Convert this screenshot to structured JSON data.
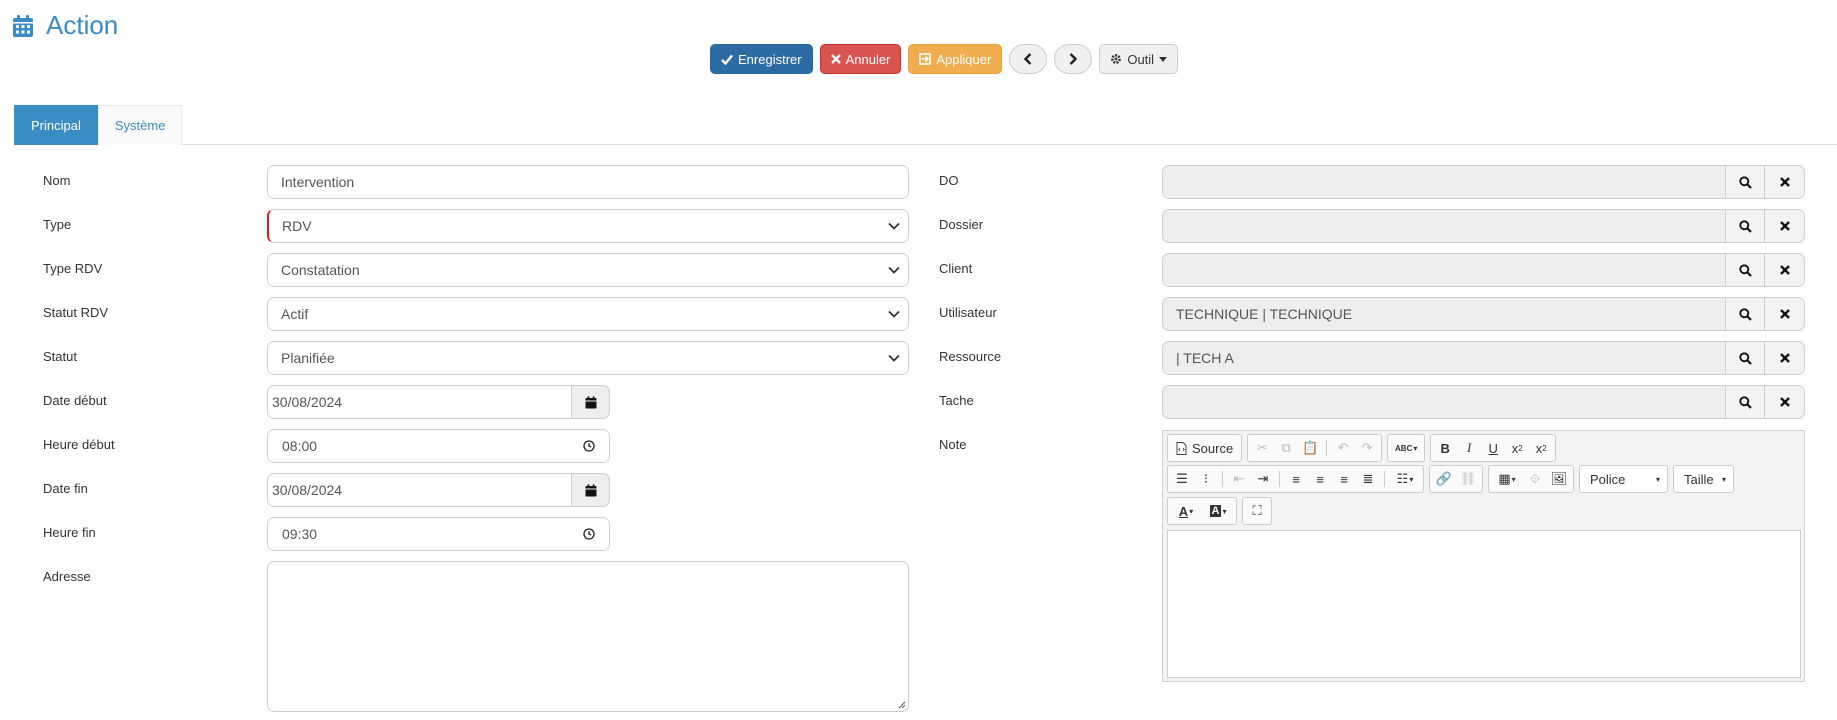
{
  "header": {
    "title": "Action",
    "icon": "calendar-icon"
  },
  "toolbar": {
    "save_label": "Enregistrer",
    "cancel_label": "Annuler",
    "apply_label": "Appliquer",
    "tool_label": "Outil"
  },
  "tabs": [
    {
      "label": "Principal"
    },
    {
      "label": "Système"
    }
  ],
  "left_form": {
    "nom": {
      "label": "Nom",
      "value": "Intervention"
    },
    "type": {
      "label": "Type",
      "value": "RDV"
    },
    "type_rdv": {
      "label": "Type RDV",
      "value": "Constatation"
    },
    "statut_rdv": {
      "label": "Statut RDV",
      "value": "Actif"
    },
    "statut": {
      "label": "Statut",
      "value": "Planifiée"
    },
    "date_debut": {
      "label": "Date début",
      "value": "30/08/2024"
    },
    "heure_debut": {
      "label": "Heure début",
      "value": "08:00"
    },
    "date_fin": {
      "label": "Date fin",
      "value": "30/08/2024"
    },
    "heure_fin": {
      "label": "Heure fin",
      "value": "09:30"
    },
    "adresse": {
      "label": "Adresse",
      "value": ""
    }
  },
  "right_form": {
    "do": {
      "label": "DO",
      "value": ""
    },
    "dossier": {
      "label": "Dossier",
      "value": ""
    },
    "client": {
      "label": "Client",
      "value": ""
    },
    "utilisateur": {
      "label": "Utilisateur",
      "value": "TECHNIQUE | TECHNIQUE"
    },
    "ressource": {
      "label": "Ressource",
      "value": " | TECH A"
    },
    "tache": {
      "label": "Tache",
      "value": ""
    },
    "note": {
      "label": "Note"
    }
  },
  "editor": {
    "source_label": "Source",
    "font_label": "Police",
    "size_label": "Taille"
  },
  "colors": {
    "accent": "#3a8cc4",
    "primary": "#2d6ca2",
    "danger": "#d9534f",
    "warning": "#f0ad4e"
  }
}
